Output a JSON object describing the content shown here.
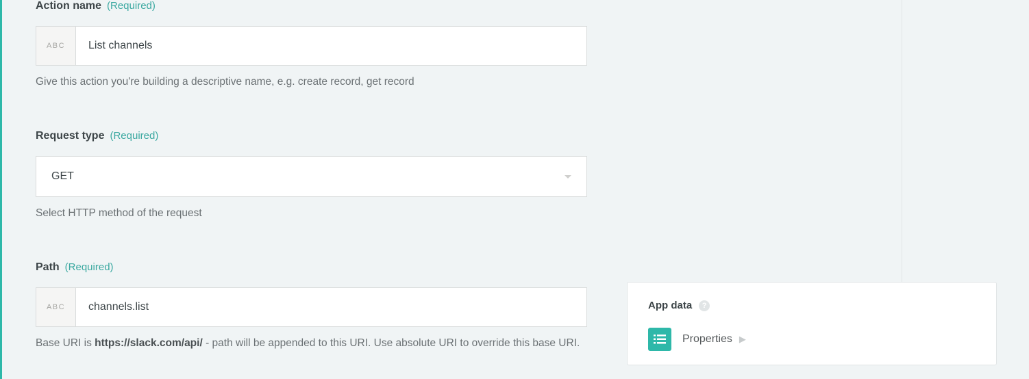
{
  "required_tag": "(Required)",
  "action_name": {
    "label": "Action name",
    "prefix": "ABC",
    "value": "List channels",
    "help": "Give this action you're building a descriptive name, e.g. create record, get record"
  },
  "request_type": {
    "label": "Request type",
    "value": "GET",
    "help": "Select HTTP method of the request"
  },
  "path": {
    "label": "Path",
    "prefix": "ABC",
    "value": "channels.list",
    "help_pre": "Base URI is ",
    "help_bold": "https://slack.com/api/",
    "help_post": " - path will be appended to this URI. Use absolute URI to override this base URI."
  },
  "sidebar": {
    "title": "App data",
    "properties_label": "Properties"
  }
}
